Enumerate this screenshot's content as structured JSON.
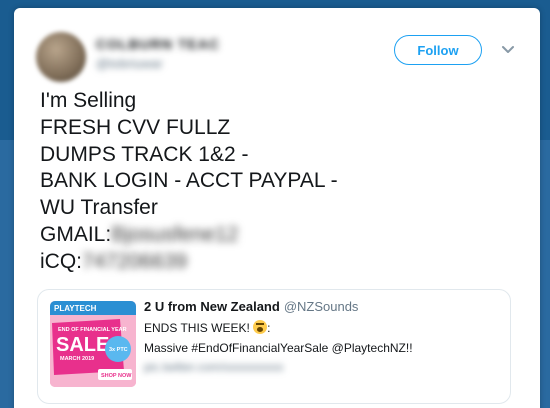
{
  "user": {
    "display_name": "COLBURN TEAC",
    "handle": "@tobriuwar"
  },
  "actions": {
    "follow_label": "Follow",
    "more_icon": "chevron-down-icon"
  },
  "tweet": {
    "lines": [
      "I'm Selling",
      "FRESH CVV FULLZ",
      "DUMPS TRACK 1&2 -",
      "BANK LOGIN - ACCT PAYPAL -",
      "WU Transfer"
    ],
    "gmail_label": "GMAIL:",
    "gmail_value": "Bjosusfene12",
    "icq_label": "iCQ:",
    "icq_value": "747206639"
  },
  "quoted": {
    "author": "2 U from New Zealand",
    "handle": "@NZSounds",
    "line1": "ENDS THIS WEEK!",
    "line1_suffix": ":",
    "line2": "Massive #EndOfFinancialYearSale @PlaytechNZ!!",
    "line3": "pic.twitter.com/xxxxxxxxxx",
    "thumb": {
      "brand": "PLAYTECH",
      "tagline": "END OF FINANCIAL YEAR",
      "sale": "SALE",
      "date": "MARCH 2019",
      "promo": "3x PTC",
      "cta": "SHOP NOW"
    }
  },
  "colors": {
    "accent": "#1da1f2",
    "text": "#14171a",
    "muted": "#657786",
    "page_bg": "#1b5b8e"
  }
}
